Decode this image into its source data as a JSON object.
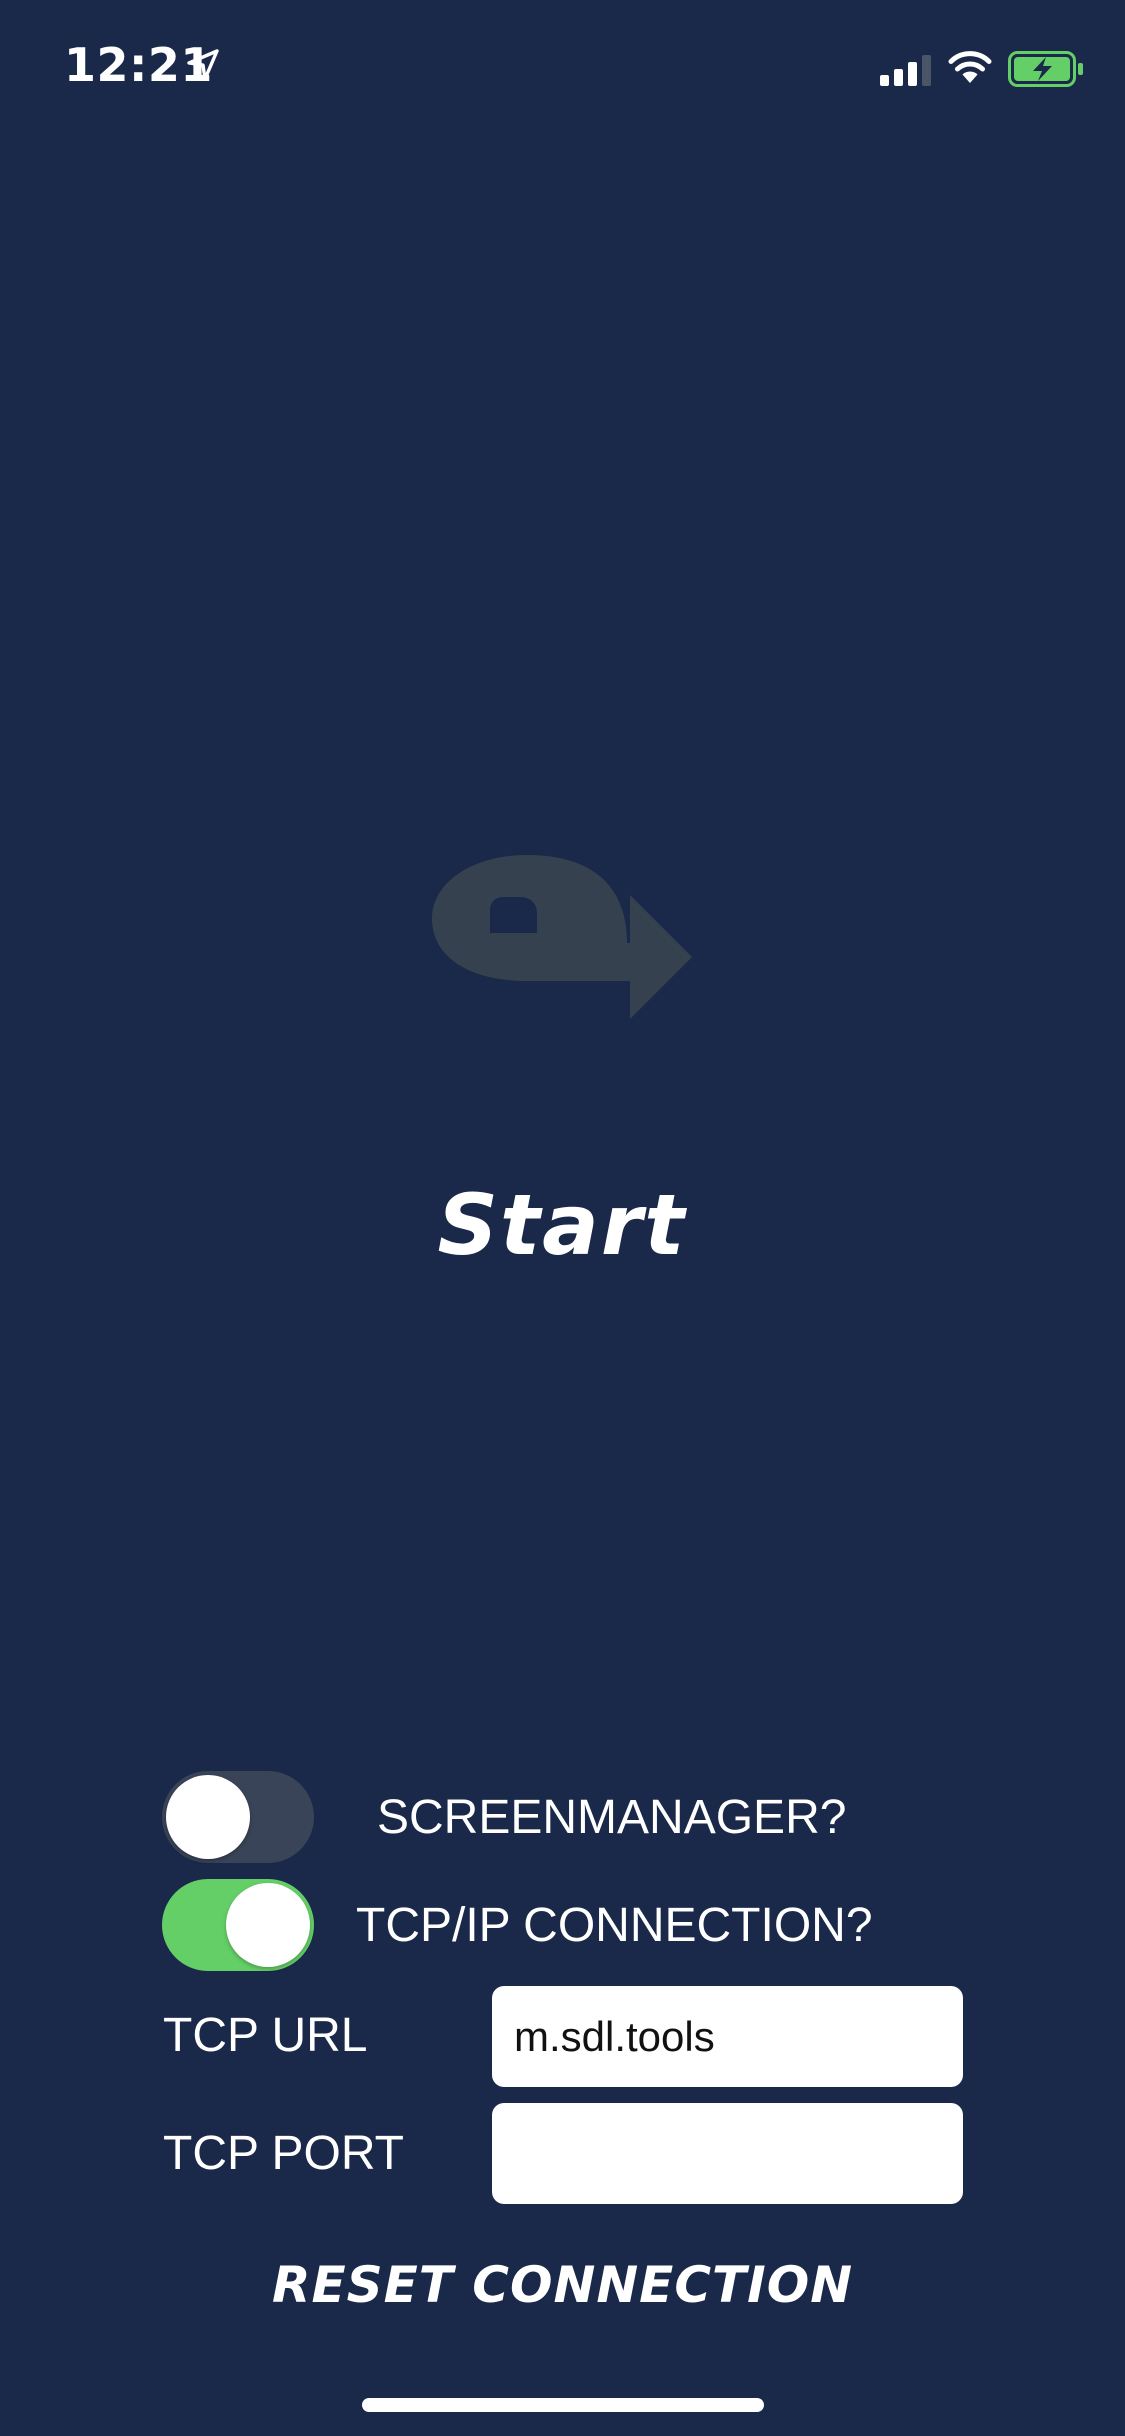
{
  "status_bar": {
    "time": "12:21",
    "icons": [
      "location-arrow-icon",
      "cellular-signal-icon",
      "wifi-icon",
      "battery-charging-icon"
    ],
    "battery_color": "#65cf67"
  },
  "main": {
    "logo_icon": "sdl-logo-arrow-icon",
    "logo_color": "#36414f",
    "start_label": "Start"
  },
  "settings": {
    "screenmanager": {
      "label": "SCREENMANAGER?",
      "enabled": false
    },
    "tcp_connection": {
      "label": "TCP/IP CONNECTION?",
      "enabled": true
    },
    "tcp_url": {
      "label": "TCP URL",
      "value": "m.sdl.tools"
    },
    "tcp_port": {
      "label": "TCP PORT",
      "value": ""
    },
    "reset_label": "RESET CONNECTION"
  },
  "colors": {
    "background": "#1a2849",
    "toggle_on": "#65cf67",
    "toggle_off": "#3a4458",
    "text": "#ffffff"
  }
}
